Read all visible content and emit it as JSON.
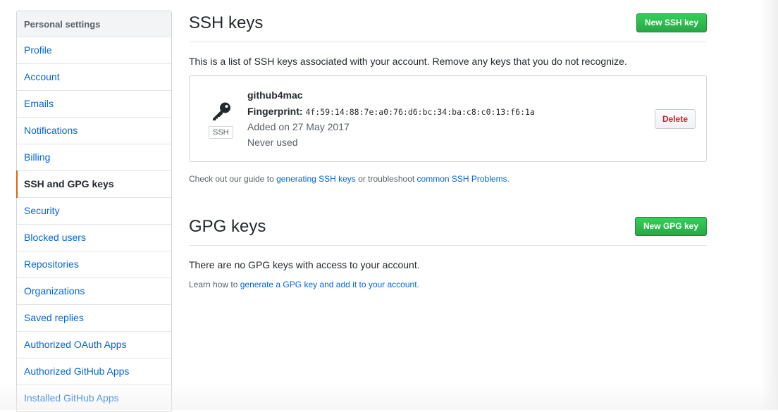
{
  "sidebar": {
    "header": "Personal settings",
    "items": [
      {
        "label": "Profile"
      },
      {
        "label": "Account"
      },
      {
        "label": "Emails"
      },
      {
        "label": "Notifications"
      },
      {
        "label": "Billing"
      },
      {
        "label": "SSH and GPG keys",
        "selected": true
      },
      {
        "label": "Security"
      },
      {
        "label": "Blocked users"
      },
      {
        "label": "Repositories"
      },
      {
        "label": "Organizations"
      },
      {
        "label": "Saved replies"
      },
      {
        "label": "Authorized OAuth Apps"
      },
      {
        "label": "Authorized GitHub Apps"
      },
      {
        "label": "Installed GitHub Apps"
      }
    ]
  },
  "ssh": {
    "title": "SSH keys",
    "new_button": "New SSH key",
    "intro": "This is a list of SSH keys associated with your account. Remove any keys that you do not recognize.",
    "key": {
      "icon": "key-icon",
      "type_label": "SSH",
      "name": "github4mac",
      "fingerprint_label": "Fingerprint:",
      "fingerprint": "4f:59:14:88:7e:a0:76:d6:bc:34:ba:c8:c0:13:f6:1a",
      "added": "Added on 27 May 2017",
      "usage": "Never used",
      "delete_button": "Delete"
    },
    "guide": {
      "prefix": "Check out our guide to ",
      "link1": "generating SSH keys",
      "middle": " or troubleshoot ",
      "link2": "common SSH Problems",
      "suffix": "."
    }
  },
  "gpg": {
    "title": "GPG keys",
    "new_button": "New GPG key",
    "empty": "There are no GPG keys with access to your account.",
    "learn": {
      "prefix": "Learn how to ",
      "link": "generate a GPG key and add it to your account",
      "suffix": "."
    }
  },
  "colors": {
    "link": "#0366d6",
    "selected_marker": "#e36209",
    "primary_button": "#28a745",
    "danger": "#cb2431"
  }
}
